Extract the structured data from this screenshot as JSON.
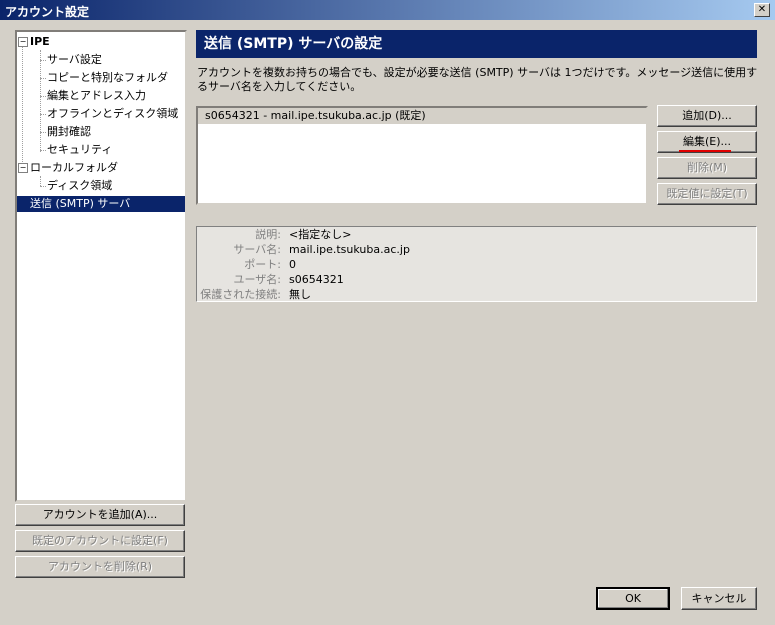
{
  "window": {
    "title": "アカウント設定",
    "close_label": "✕"
  },
  "tree": {
    "account": "IPE",
    "account_items": [
      "サーバ設定",
      "コピーと特別なフォルダ",
      "編集とアドレス入力",
      "オフラインとディスク領域",
      "開封確認",
      "セキュリティ"
    ],
    "local": "ローカルフォルダ",
    "local_items": [
      "ディスク領域"
    ],
    "smtp": "送信 (SMTP) サーバ"
  },
  "left_buttons": {
    "add_account": "アカウントを追加(A)...",
    "set_default": "既定のアカウントに設定(F)",
    "remove_account": "アカウントを削除(R)"
  },
  "panel": {
    "heading": "送信 (SMTP) サーバの設定",
    "description": "アカウントを複数お持ちの場合でも、設定が必要な送信 (SMTP) サーバは 1つだけです。メッセージ送信に使用するサーバ名を入力してください。"
  },
  "server_list": {
    "rows": [
      "s0654321 - mail.ipe.tsukuba.ac.jp (既定)"
    ]
  },
  "server_buttons": {
    "add": "追加(D)...",
    "edit": "編集(E)...",
    "delete": "削除(M)",
    "set_default": "既定値に設定(T)"
  },
  "details": {
    "description_label": "説明:",
    "description_value": "<指定なし>",
    "server_label": "サーバ名:",
    "server_value": "mail.ipe.tsukuba.ac.jp",
    "port_label": "ポート:",
    "port_value": "0",
    "user_label": "ユーザ名:",
    "user_value": "s0654321",
    "secure_label": "保護された接続:",
    "secure_value": "無し"
  },
  "footer": {
    "ok": "OK",
    "cancel": "キャンセル"
  },
  "colors": {
    "titlebar_start": "#0a246a",
    "titlebar_end": "#a6caf0",
    "selection": "#0a246a",
    "highlight_line": "#e00000"
  }
}
